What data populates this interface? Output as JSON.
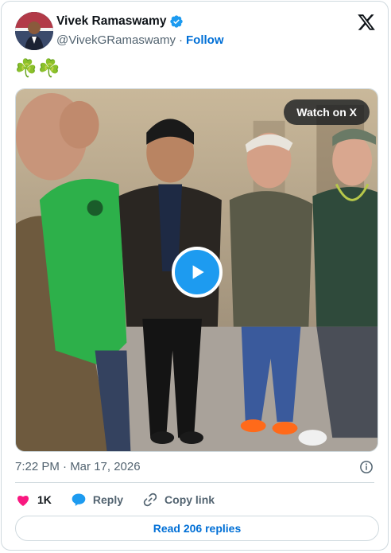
{
  "author": {
    "name": "Vivek Ramaswamy",
    "handle": "@VivekGRamaswamy",
    "separator": "·",
    "follow_label": "Follow"
  },
  "tweet": {
    "text": "☘️☘️",
    "timestamp": "7:22 PM · Mar 17, 2026"
  },
  "media": {
    "watch_label": "Watch on X"
  },
  "actions": {
    "like_count": "1K",
    "reply_label": "Reply",
    "copy_link_label": "Copy link",
    "read_replies_label": "Read 206 replies"
  },
  "colors": {
    "brand_blue": "#1d9bf0",
    "link_blue": "#006fd6",
    "like_pink": "#f91880",
    "muted": "#536471",
    "border": "#cfd9de"
  }
}
